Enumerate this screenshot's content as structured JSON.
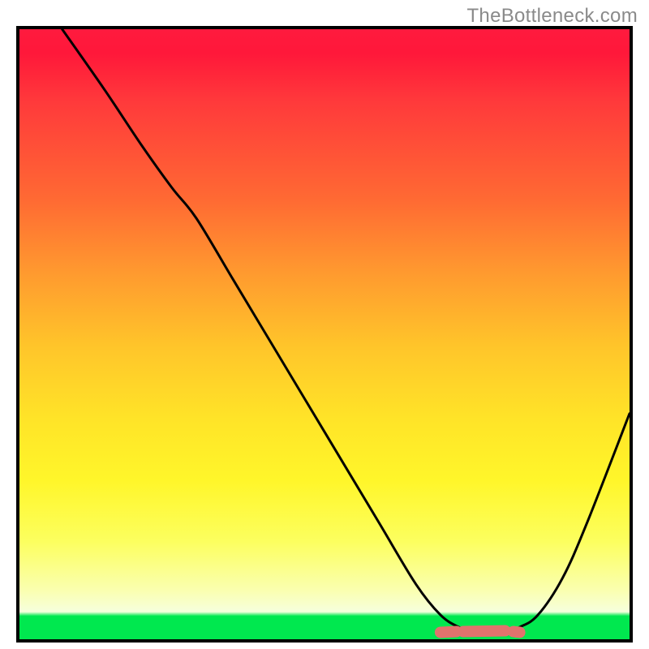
{
  "watermark": "TheBottleneck.com",
  "chart_data": {
    "type": "line",
    "title": "",
    "xlabel": "",
    "ylabel": "",
    "xlim": [
      0,
      100
    ],
    "ylim": [
      0,
      100
    ],
    "series": [
      {
        "name": "curve",
        "x": [
          7,
          14,
          20,
          25,
          29,
          35,
          41,
          47,
          53,
          59,
          65,
          69,
          72,
          75,
          79,
          82,
          85,
          89,
          93,
          100
        ],
        "y": [
          100,
          90,
          81,
          74,
          69,
          59,
          49,
          39,
          29,
          19,
          9,
          4,
          2,
          1,
          1,
          2,
          4,
          10,
          19,
          37
        ]
      }
    ],
    "gradient_stops": [
      {
        "pos": 0.0,
        "color": "#ff1a3e"
      },
      {
        "pos": 0.28,
        "color": "#ff6a33"
      },
      {
        "pos": 0.52,
        "color": "#ffc52a"
      },
      {
        "pos": 0.74,
        "color": "#fff62a"
      },
      {
        "pos": 0.92,
        "color": "#faffb0"
      },
      {
        "pos": 0.962,
        "color": "#00e84f"
      },
      {
        "pos": 1.0,
        "color": "#00e84f"
      }
    ],
    "marker": {
      "color": "#e0736d",
      "x_range": [
        69,
        82
      ],
      "y": 1
    }
  }
}
